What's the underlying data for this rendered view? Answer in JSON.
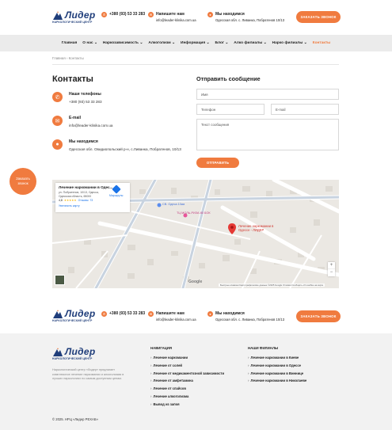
{
  "header": {
    "logo_word": "Лидер",
    "logo_sub": "НАРКОЛОГИЧЕСКИЙ ЦЕНТР",
    "phone": "+380 (93) 53 33 283",
    "write_title": "Напишите нам",
    "email": "info@leader-klinika.com.ua",
    "location_title": "Мы находимся",
    "location_value": "Одесская обл. с. Ливанка, Побратенов 10/13",
    "cta_label": "ЗАКАЗАТЬ ЗВОНОК"
  },
  "nav": {
    "items": [
      {
        "label": "Главная",
        "active": false
      },
      {
        "label": "О нас ⌄",
        "active": false
      },
      {
        "label": "Наркозависимость ⌄",
        "active": false
      },
      {
        "label": "Алкоголизм ⌄",
        "active": false
      },
      {
        "label": "Информация ⌄",
        "active": false
      },
      {
        "label": "Блог ⌄",
        "active": false
      },
      {
        "label": "Алко филиалы ⌄",
        "active": false
      },
      {
        "label": "Нарко филиалы ⌄",
        "active": false
      },
      {
        "label": "Контакты",
        "active": true
      }
    ]
  },
  "breadcrumb": {
    "home": "Главная",
    "sep": "›",
    "current": "Контакты"
  },
  "contacts": {
    "title": "Контакты",
    "phone_title": "Наши телефоны",
    "phone_value": "+380 (93) 53 33 283",
    "email_title": "E-mail",
    "email_value": "info@leader-klinika.com.ua",
    "address_title": "Мы находимся",
    "address_value": "Одесская обл. Овидиопольский р-н, с.Ливанка, Побратенов, 10/13"
  },
  "form": {
    "title": "Отправить сообщение",
    "name_placeholder": "Имя",
    "phone_placeholder": "Телефон",
    "email_placeholder": "E-mail",
    "message_placeholder": "Текст сообщения",
    "submit_label": "ОТПРАВИТЬ"
  },
  "callback": {
    "line1": "Заказать",
    "line2": "звонок"
  },
  "map": {
    "card_title": "Лечение наркомании в Одес...",
    "card_address": "ул. Побратенов, 10/13, Одесса, Одесская область, 65000",
    "card_rating": "4,8",
    "card_stars": "★★★★★",
    "card_reviews": "Отзывы: 73",
    "card_route": "Маршруты",
    "card_link": "Увеличить карту",
    "pin_label": "Лечение наркомании в Одессе - ЛИДЕР",
    "poi1": "СВ. Одеса 10км",
    "poi2": "ТЦ МОЛЬ-РИЗА 80 БОК",
    "zoom_in": "+",
    "zoom_out": "−",
    "google": "Google",
    "attribution": "Быстрые клавиши   Картографические данные ©2025 Google   Условия   Сообщить об ошибке на карте"
  },
  "footer": {
    "phone": "+380 (93) 53 33 283",
    "write_title": "Напишите нам",
    "email": "info@leader-klinika.com.ua",
    "location_title": "Мы находимся",
    "location_value": "Одесская обл. с. Ливанка, Побратенов 10/13",
    "cta_label": "ЗАКАЗАТЬ ЗВОНОК",
    "about_text": "Наркологический центр «Лидер» предлагает комплексное лечение наркомании и алкоголизма в лучших наркологиях по самым доступным ценам.",
    "nav_title": "НАВИГАЦИЯ",
    "nav_links": [
      "Лечение наркомании",
      "Лечение от солей",
      "Лечение от медикаментозной зависимости",
      "Лечение от амфетамина",
      "Лечение от спайсов",
      "Лечение алкоголизма",
      "Вывод из запоя"
    ],
    "branches_title": "НАШИ ФИЛИАЛЫ",
    "branch_links": [
      "Лечение наркомании в Киеве",
      "Лечение наркомании в Одессе",
      "Лечение наркомании в Виннице",
      "Лечение наркомании в Николаеве"
    ],
    "copyright": "© 2025. НРЦ «Лидер РЕХАБ»"
  }
}
